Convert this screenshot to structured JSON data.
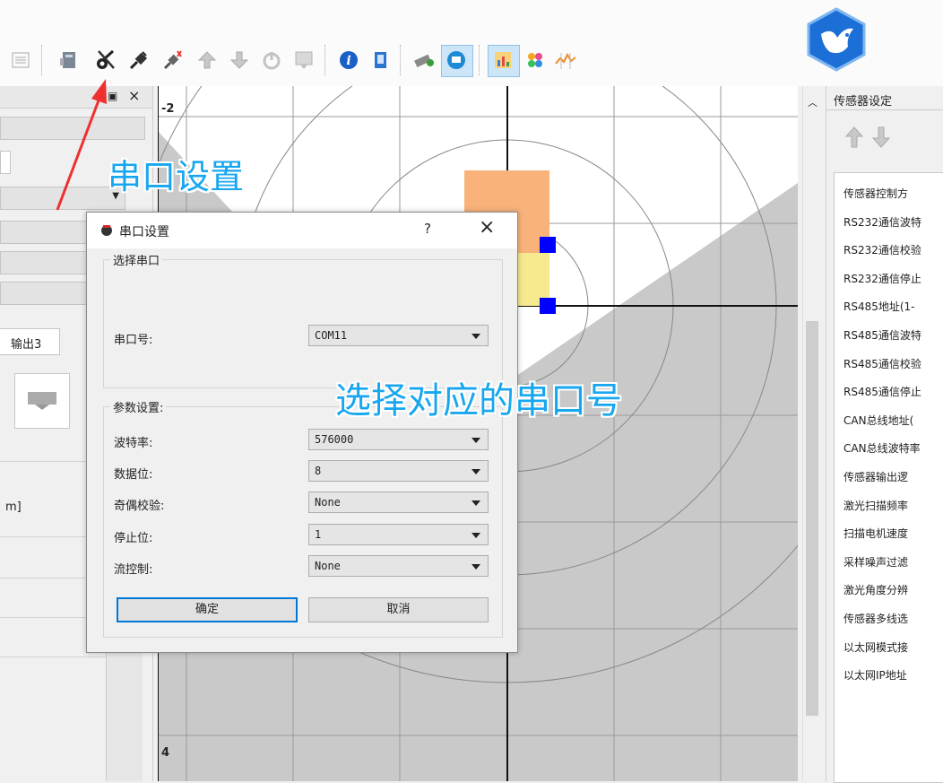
{
  "toolbar": {
    "icons": [
      "list-icon",
      "device-icon",
      "serial-settings-icon",
      "connect-icon",
      "disconnect-icon",
      "upload-icon",
      "download-icon",
      "power-icon",
      "save-icon",
      "info-icon",
      "export-icon",
      "tool-icon",
      "display-icon",
      "chart-icon",
      "palette-icon",
      "waveform-icon"
    ]
  },
  "left_panel": {
    "tab_label": "输出3",
    "unit_text": "m]"
  },
  "plot": {
    "top_label": "-2",
    "bottom_label": "4"
  },
  "right_panel": {
    "title": "传感器设定",
    "items": [
      "传感器控制方",
      "RS232通信波特",
      "RS232通信校验",
      "RS232通信停止",
      "RS485地址(1-",
      "RS485通信波特",
      "RS485通信校验",
      "RS485通信停止",
      "CAN总线地址(",
      "CAN总线波特率",
      "传感器输出逻",
      "激光扫描频率",
      "扫描电机速度",
      "采样噪声过滤",
      "激光角度分辨",
      "传感器多线选",
      "以太网模式接",
      "以太网IP地址"
    ]
  },
  "dialog": {
    "title": "串口设置",
    "help": "?",
    "close": "×",
    "port_group": "选择串口",
    "port_label": "串口号:",
    "port_value": "COM11",
    "param_group": "参数设置:",
    "fields": [
      {
        "label": "波特率:",
        "value": "576000"
      },
      {
        "label": "数据位:",
        "value": "8"
      },
      {
        "label": "奇偶校验:",
        "value": "None"
      },
      {
        "label": "停止位:",
        "value": "1"
      },
      {
        "label": "流控制:",
        "value": "None"
      }
    ],
    "ok": "确定",
    "cancel": "取消"
  },
  "annotations": {
    "serial_settings": "串口设置",
    "select_port": "选择对应的串口号"
  },
  "colors": {
    "accent": "#18a7ef",
    "arrow": "#ee3030",
    "plot_bg": "#c9c9c9",
    "orange": "#f8b27a",
    "yellow": "#f7e98e",
    "marker": "#0000ff",
    "logo": "#1c6fd6"
  }
}
